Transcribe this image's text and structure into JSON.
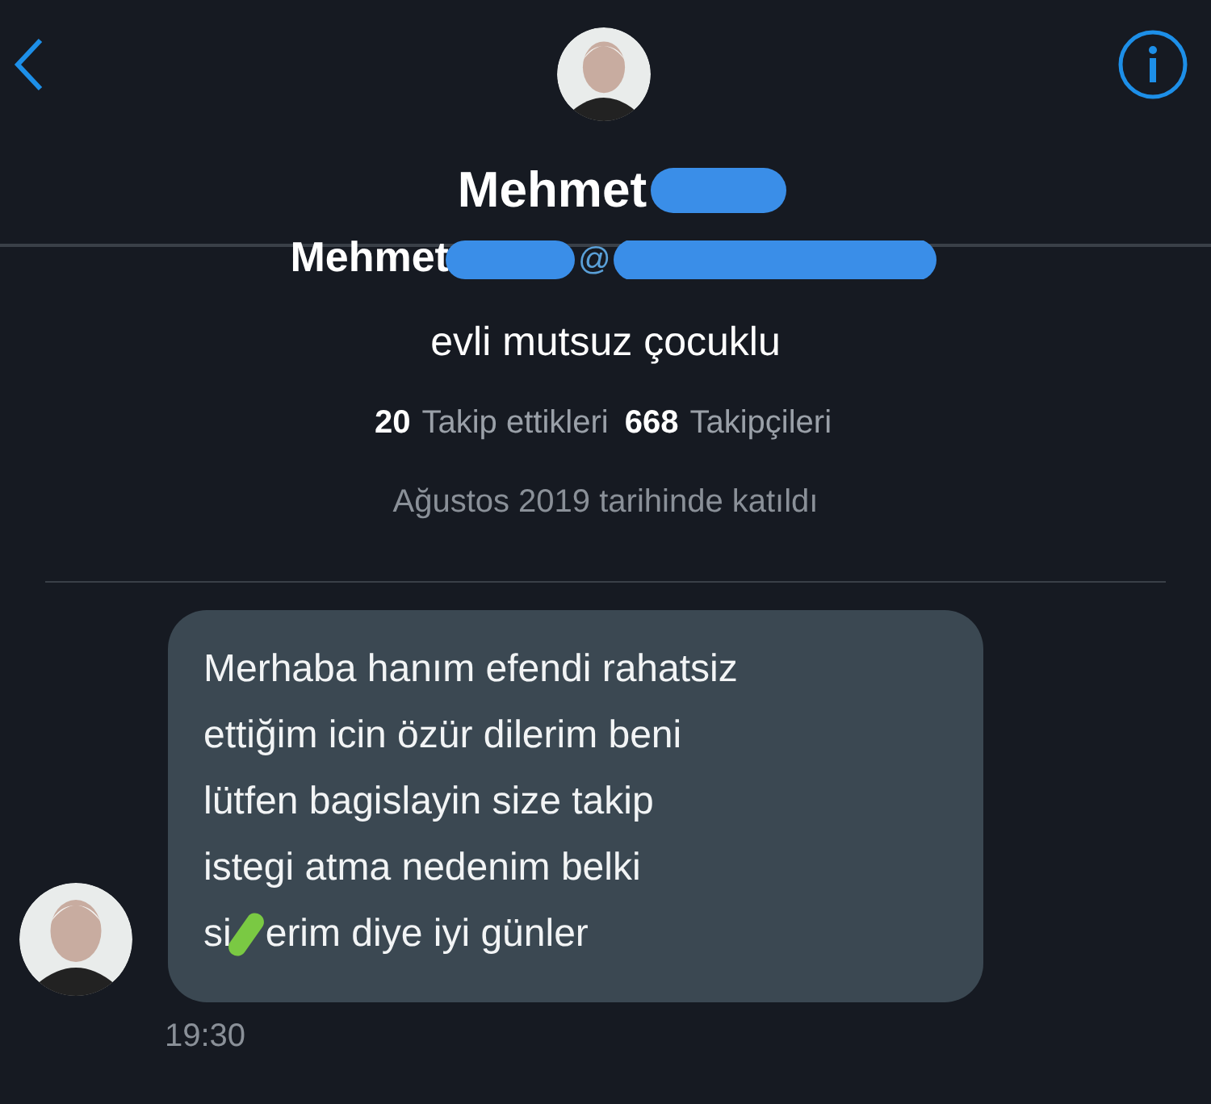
{
  "header": {
    "name": "Mehmet"
  },
  "profile": {
    "display_name": "Mehmet",
    "at_sign": "@",
    "bio": "evli mutsuz çocuklu",
    "following_count": "20",
    "following_label": "Takip ettikleri",
    "followers_count": "668",
    "followers_label": "Takipçileri",
    "joined": "Ağustos 2019 tarihinde katıldı"
  },
  "message": {
    "lines": [
      "Merhaba hanım efendi rahatsiz",
      "ettiğim icin özür dilerim beni",
      "lütfen bagislayin size takip",
      "istegi atma nedenim belki"
    ],
    "text_before_mark": "si",
    "text_after_mark": "erim diye iyi günler",
    "time": "19:30"
  }
}
